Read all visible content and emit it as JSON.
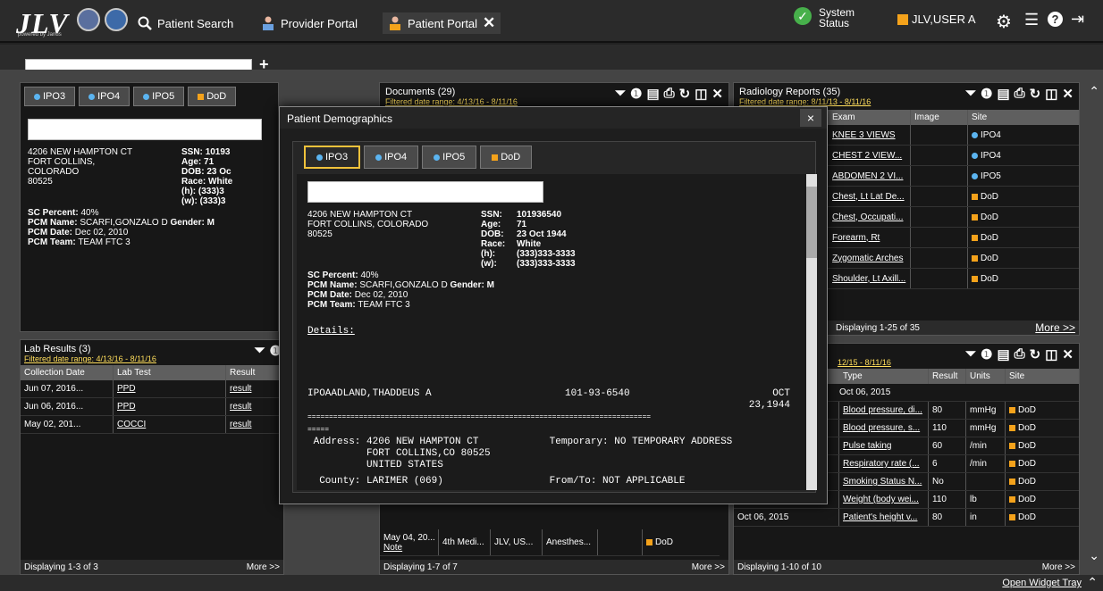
{
  "topbar": {
    "logo": "JLV",
    "logo_sub": "powered by Janus",
    "nav": [
      {
        "label": "Patient Search",
        "icon": "search-icon"
      },
      {
        "label": "Provider Portal",
        "icon": "provider-icon"
      },
      {
        "label": "Patient Portal",
        "icon": "patient-icon"
      }
    ],
    "system_status": "System\nStatus",
    "system_status_1": "System",
    "system_status_2": "Status",
    "user": "JLV,USER A"
  },
  "sites": [
    "IPO3",
    "IPO4",
    "IPO5",
    "DoD"
  ],
  "demographics": {
    "address1": "4206 NEW HAMPTON CT",
    "address2": "FORT COLLINS, COLORADO",
    "zip": "80525",
    "ssn_label": "SSN:",
    "ssn": "101936540",
    "age_label": "Age:",
    "age": "71",
    "dob_label": "DOB:",
    "dob": "23 Oct 1944",
    "race_label": "Race:",
    "race": "White",
    "h_label": "(h):",
    "h": "(333)333-3333",
    "w_label": "(w):",
    "w": "(333)333-3333",
    "sc_label": "SC Percent:",
    "sc": "40%",
    "pcm_name_label": "PCM Name:",
    "pcm_name": "SCARFI,GONZALO D",
    "gender_label": "Gender:",
    "gender": "M",
    "pcm_date_label": "PCM Date:",
    "pcm_date": "Dec 02, 2010",
    "pcm_team_label": "PCM Team:",
    "pcm_team": "TEAM FTC 3",
    "left_ssn": "10193",
    "left_age": "71",
    "left_dob": "23 Oc",
    "left_race": "White",
    "left_h": "(333)3",
    "left_w": "(333)3"
  },
  "lab": {
    "title": "Lab Results (3)",
    "filter": "Filtered date range: 4/13/16 - 8/11/16",
    "columns": [
      "Collection Date",
      "Lab Test",
      "Result"
    ],
    "rows": [
      [
        "Jun 07, 2016...",
        "PPD",
        "result"
      ],
      [
        "Jun 06, 2016...",
        "PPD",
        "result"
      ],
      [
        "May 02, 201...",
        "COCCI",
        "result"
      ]
    ],
    "footer": "Displaying 1-3 of 3",
    "more": "More >>"
  },
  "documents": {
    "title": "Documents (29)",
    "filter": "Filtered date range: 4/13/16 - 8/11/16",
    "rows": [
      [
        "May 04, 20...",
        "4th Medi...",
        "JLV, US...",
        "Anesthes..."
      ]
    ],
    "row_note": "Note",
    "footer": "Displaying 1-7 of 7",
    "more": "More >>"
  },
  "radiology": {
    "title": "Radiology Reports (35)",
    "filter": "Filtered date range: 8/11/13 - 8/11/16",
    "columns": [
      "Exam",
      "Image",
      "Site"
    ],
    "rows": [
      [
        "KNEE 3 VIEWS",
        "IPO4"
      ],
      [
        "CHEST 2 VIEW...",
        "IPO4"
      ],
      [
        "ABDOMEN 2 VI...",
        "IPO5"
      ],
      [
        "Chest, Lt Lat De...",
        "DoD"
      ],
      [
        "Chest, Occupati...",
        "DoD"
      ],
      [
        "Forearm, Rt",
        "DoD"
      ],
      [
        "Zygomatic Arches",
        "DoD"
      ],
      [
        "Shoulder, Lt Axill...",
        "DoD"
      ]
    ],
    "footer": "Displaying 1-25 of 35",
    "more": "More >>"
  },
  "vitals": {
    "filter": "12/15 - 8/11/16",
    "columns": [
      "Type",
      "Result",
      "Units",
      "Site"
    ],
    "group": "Oct 06, 2015",
    "rows": [
      [
        "",
        "Blood pressure, di...",
        "80",
        "mmHg",
        "DoD"
      ],
      [
        "",
        "Blood pressure, s...",
        "110",
        "mmHg",
        "DoD"
      ],
      [
        "",
        "Pulse taking",
        "60",
        "/min",
        "DoD"
      ],
      [
        "",
        "Respiratory rate (...",
        "6",
        "/min",
        "DoD"
      ],
      [
        "Oct 06, 2015",
        "Smoking Status N...",
        "No",
        "",
        "DoD"
      ],
      [
        "Oct 06, 2015",
        "Weight (body wei...",
        "110",
        "lb",
        "DoD"
      ],
      [
        "Oct 06, 2015",
        "Patient's height v...",
        "80",
        "in",
        "DoD"
      ]
    ],
    "footer": "Displaying 1-10 of 10",
    "more": "More >>"
  },
  "modal": {
    "title": "Patient Demographics",
    "close": "×",
    "details": "Details:",
    "report_name": "IPOAADLAND,THADDEUS A",
    "report_ssn": "101-93-6540",
    "report_dob": "OCT\n23,1944",
    "rule": "================================================================================",
    "rule2": "=====",
    "addr_line": " Address: 4206 NEW HAMPTON CT            Temporary: NO TEMPORARY ADDRESS",
    "addr_line2": "          FORT COLLINS,CO 80525",
    "addr_line3": "          UNITED STATES",
    "county_line": "  County: LARIMER (069)                  From/To: NOT APPLICABLE"
  },
  "bottom": {
    "widget_tray": "Open Widget Tray"
  }
}
